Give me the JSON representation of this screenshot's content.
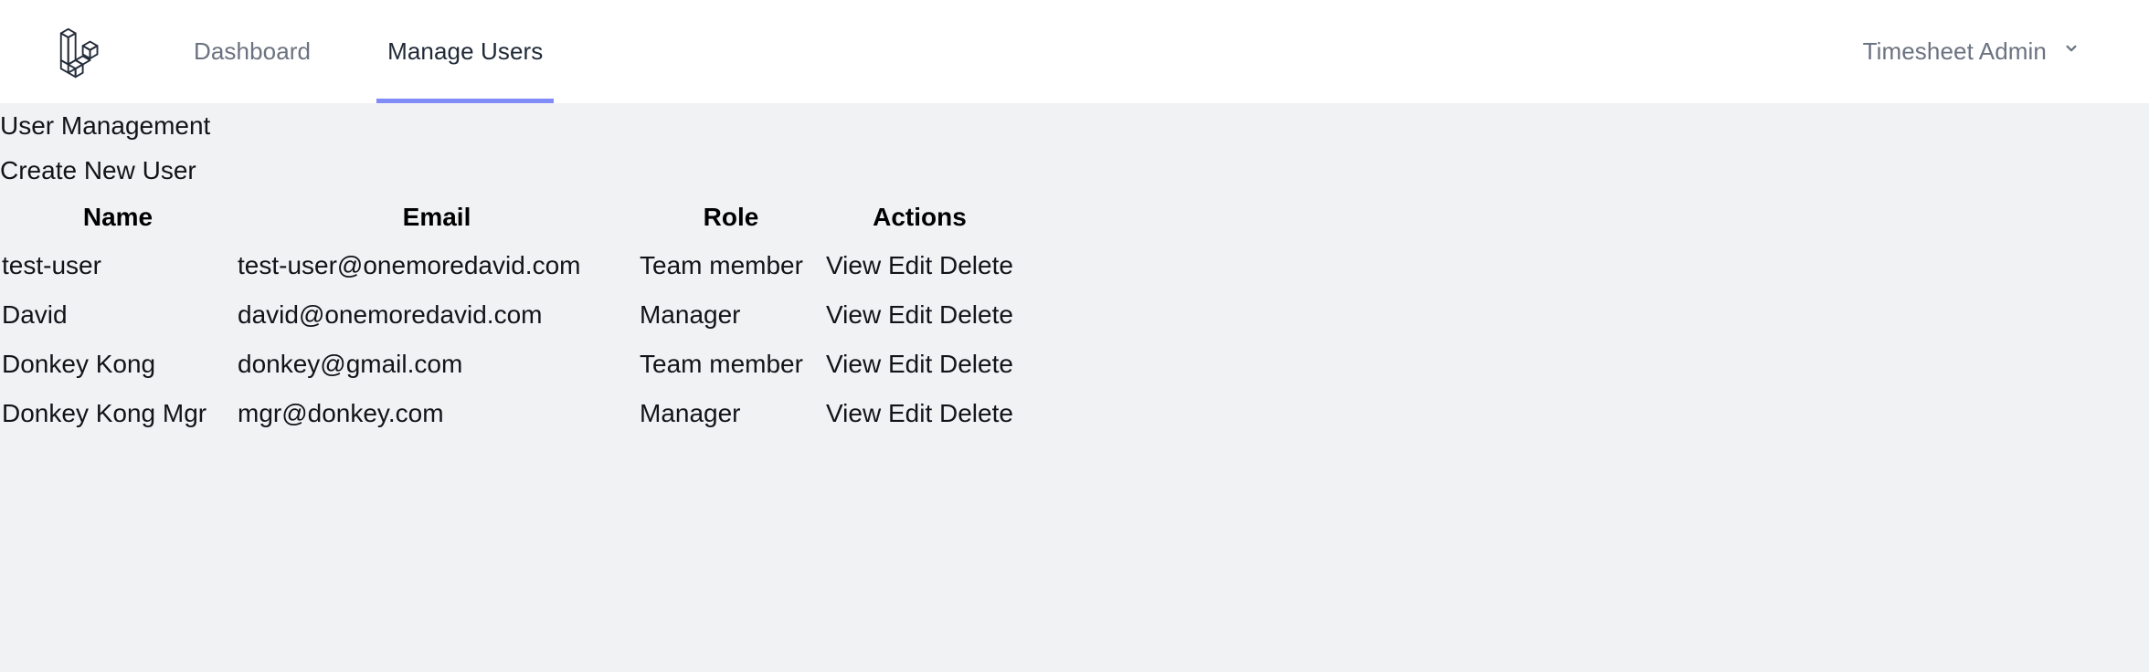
{
  "navbar": {
    "logo_icon": "laravel-logo-icon",
    "links": [
      {
        "label": "Dashboard",
        "active": false
      },
      {
        "label": "Manage Users",
        "active": true
      }
    ],
    "user_menu": {
      "label": "Timesheet Admin",
      "icon": "chevron-down-icon"
    },
    "accent_color": "#818cf8",
    "inactive_link_color": "#6b7280",
    "background_color": "#ffffff"
  },
  "page": {
    "background_color": "#f1f2f4",
    "heading": "User Management",
    "create_link": "Create New User"
  },
  "table": {
    "columns": [
      "Name",
      "Email",
      "Role",
      "Actions"
    ],
    "actions": [
      "View",
      "Edit",
      "Delete"
    ],
    "rows": [
      {
        "name": "test-user",
        "email": "test-user@onemoredavid.com",
        "role": "Team member",
        "view": "View",
        "edit": "Edit",
        "delete": "Delete"
      },
      {
        "name": "David",
        "email": "david@onemoredavid.com",
        "role": "Manager",
        "view": "View",
        "edit": "Edit",
        "delete": "Delete"
      },
      {
        "name": "Donkey Kong",
        "email": "donkey@gmail.com",
        "role": "Team member",
        "view": "View",
        "edit": "Edit",
        "delete": "Delete"
      },
      {
        "name": "Donkey Kong Mgr",
        "email": "mgr@donkey.com",
        "role": "Manager",
        "view": "View",
        "edit": "Edit",
        "delete": "Delete"
      }
    ]
  }
}
